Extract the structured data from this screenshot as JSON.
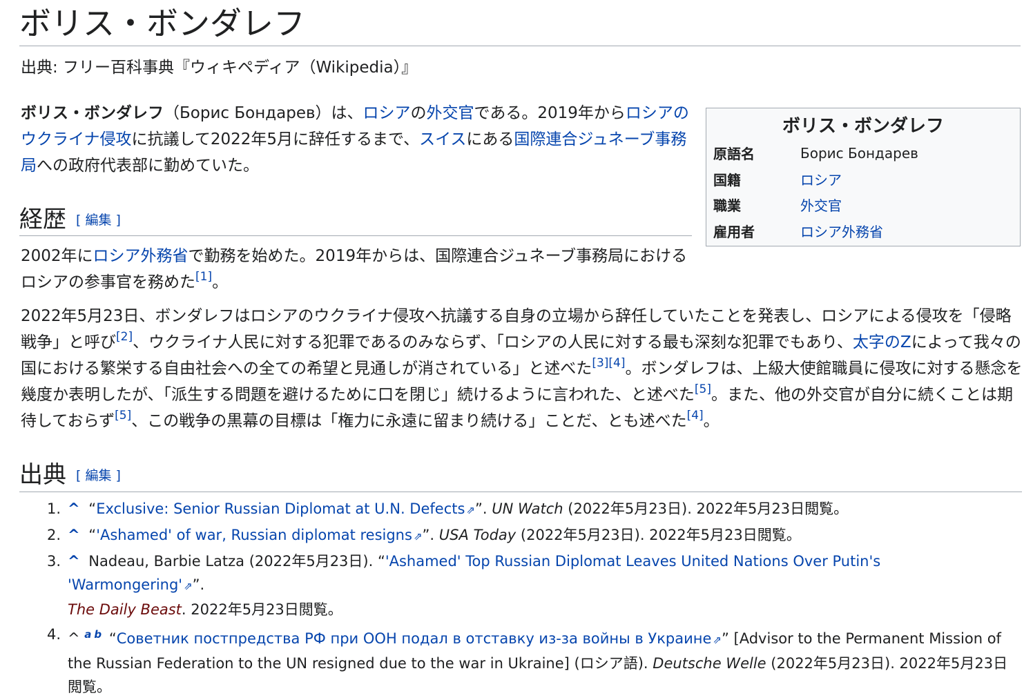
{
  "title": "ボリス・ボンダレフ",
  "tagline": "出典: フリー百科事典『ウィキペディア（Wikipedia）』",
  "lead": {
    "bold_name": "ボリス・ボンダレフ",
    "t1": "（Борис Бондарев）は、",
    "l1": "ロシア",
    "t2": "の",
    "l2": "外交官",
    "t3": "である。2019年から",
    "l3": "ロシアのウクライナ侵攻",
    "t4": "に抗議して2022年5月に辞任するまで、",
    "l4": "スイス",
    "t5": "にある",
    "l5": "国際連合ジュネーブ事務局",
    "t6": "への政府代表部に勤めていた。"
  },
  "infobox": {
    "title": "ボリス・ボンダレフ",
    "rows": [
      {
        "key": "原語名",
        "value": "Борис Бондарев"
      },
      {
        "key": "国籍",
        "value": "ロシア"
      },
      {
        "key": "職業",
        "value": "外交官"
      },
      {
        "key": "雇用者",
        "value": "ロシア外務省"
      }
    ]
  },
  "sections": {
    "history": {
      "heading": "経歴",
      "edit": "[ 編集 ]"
    },
    "sources": {
      "heading": "出典",
      "edit": "[ 編集 ]"
    }
  },
  "history_p1": {
    "t1": "2002年に",
    "l1": "ロシア外務省",
    "t2": "で勤務を始めた。2019年からは、国際連合ジュネーブ事務局におけるロシアの参事官を務めた",
    "r1": "[1]",
    "t3": "。"
  },
  "history_p2": {
    "t1": "2022年5月23日、ボンダレフはロシアのウクライナ侵攻へ抗議する自身の立場から辞任していたことを発表し、ロシアによる侵攻を「侵略戦争」と呼び",
    "r2": "[2]",
    "t2": "、ウクライナ人民に対する犯罪であるのみならず、「ロシアの人民に対する最も深刻な犯罪でもあり、",
    "l1": "太字のZ",
    "t3": "によって我々の国における繁栄する自由社会への全ての希望と見通しが消されている」と述べた",
    "r3": "[3]",
    "r4": "[4]",
    "t4": "。ボンダレフは、上級大使館職員に侵攻に対する懸念を幾度か表明したが、「派生する問題を避けるために口を閉じ」続けるように言われた、と述べた",
    "r5": "[5]",
    "t5": "。また、他の外交官が自分に続くことは期待しておらず",
    "r5b": "[5]",
    "t6": "、この戦争の黒幕の目標は「権力に永遠に留まり続ける」ことだ、とも述べた",
    "r4b": "[4]",
    "t7": "。"
  },
  "references": [
    {
      "num": "1.",
      "caret": "^",
      "pre": "“",
      "link": "Exclusive: Senior Russian Diplomat at U.N. Defects",
      "post": "”.",
      "work": "UN Watch",
      "tail": "(2022年5月23日). 2022年5月23日閲覧。"
    },
    {
      "num": "2.",
      "caret": "^",
      "pre": "“",
      "link": "'Ashamed' of war, Russian diplomat resigns",
      "post": "”.",
      "work": "USA Today",
      "tail": "(2022年5月23日). 2022年5月23日閲覧。"
    },
    {
      "num": "3.",
      "caret": "^",
      "pre": "Nadeau, Barbie Latza (2022年5月23日). “",
      "link": "'Ashamed' Top Russian Diplomat Leaves United Nations Over Putin's 'Warmongering'",
      "post": "”.",
      "work": "The Daily Beast",
      "tail": ". 2022年5月23日閲覧。"
    },
    {
      "num": "4.",
      "caret": "^",
      "a": "a",
      "b": "b",
      "pre": "“",
      "link": "Советник постпредства РФ при ООН подал в отставку из-за войны в Украине",
      "post": "” [Advisor to the Permanent Mission of the Russian Federation to the UN resigned due to the war in Ukraine] (ロシア語).",
      "work": "Deutsche Welle",
      "tail": "(2022年5月23日). 2022年5月23日閲覧。"
    }
  ],
  "icons": {
    "external_link": "external-link-icon"
  }
}
